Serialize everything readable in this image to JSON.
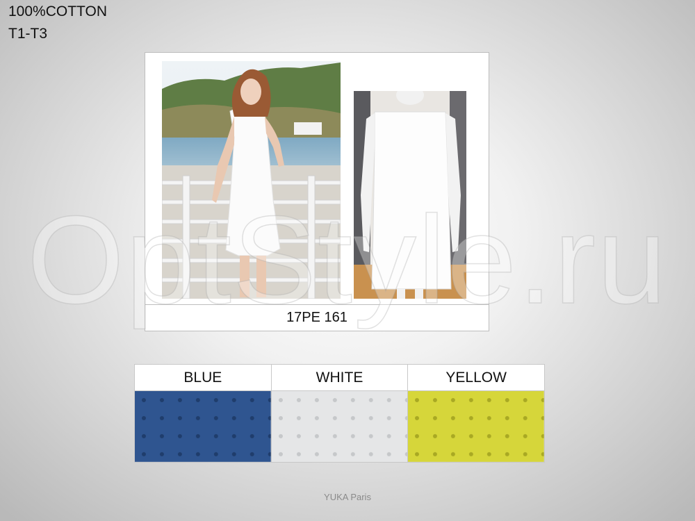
{
  "labels": {
    "material": "100%COTTON",
    "sizes": "T1-T3"
  },
  "product": {
    "code": "17PE 161"
  },
  "watermark": "OptStyle.ru",
  "colors": [
    {
      "name": "BLUE",
      "hex": "#2f5590",
      "dot": "#1f3d6c"
    },
    {
      "name": "WHITE",
      "hex": "#e5e6e7",
      "dot": "#c6c8ca"
    },
    {
      "name": "YELLOW",
      "hex": "#d6d63a",
      "dot": "#a9a923"
    }
  ],
  "brand": "YUKA Paris"
}
